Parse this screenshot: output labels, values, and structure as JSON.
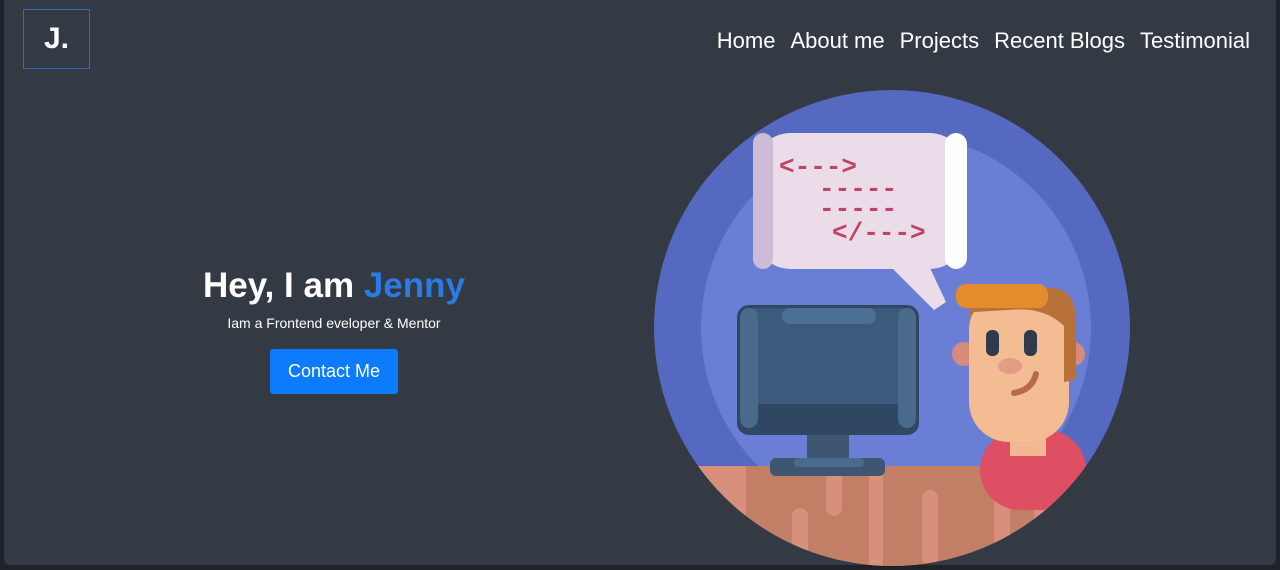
{
  "logo": {
    "text": "J."
  },
  "nav": {
    "items": [
      {
        "label": "Home"
      },
      {
        "label": "About me"
      },
      {
        "label": "Projects"
      },
      {
        "label": "Recent Blogs"
      },
      {
        "label": "Testimonial"
      }
    ]
  },
  "hero": {
    "greeting": "Hey, I am",
    "name": "Jenny",
    "subtitle": "Iam a Frontend eveloper & Mentor",
    "cta_label": "Contact Me"
  },
  "illustration": {
    "code_line_1": "<--->",
    "code_line_2": "-----",
    "code_line_3": "-----",
    "code_line_4": "</--->"
  },
  "colors": {
    "background": "#343a43",
    "accent": "#2a7be4",
    "button": "#0d7bfd",
    "circle_outer": "#5669c0",
    "circle_inner": "#6b7ed6"
  }
}
